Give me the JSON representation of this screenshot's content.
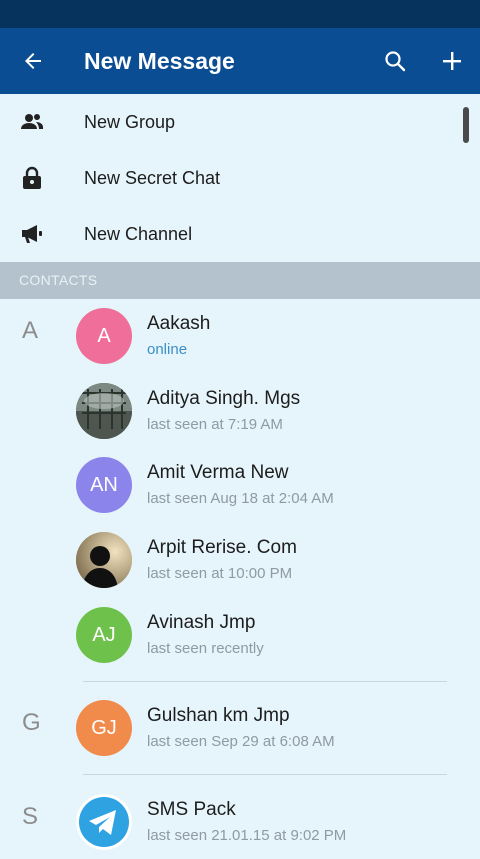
{
  "header": {
    "title": "New Message"
  },
  "actions": [
    {
      "label": "New Group",
      "icon": "group-icon"
    },
    {
      "label": "New Secret Chat",
      "icon": "lock-icon"
    },
    {
      "label": "New Channel",
      "icon": "megaphone-icon"
    }
  ],
  "section": {
    "title": "CONTACTS"
  },
  "contacts": [
    {
      "letter": "A",
      "initials": "A",
      "name": "Aakash",
      "status": "online",
      "color": "#ef6f9a"
    },
    {
      "letter": "",
      "initials": "",
      "name": "Aditya Singh. Mgs",
      "status": "last seen at 7:19 AM",
      "color": "#6d7a72"
    },
    {
      "letter": "",
      "initials": "AN",
      "name": "Amit Verma New",
      "status": "last seen Aug 18 at 2:04 AM",
      "color": "#8b84ea"
    },
    {
      "letter": "",
      "initials": "",
      "name": "Arpit Rerise. Com",
      "status": "last seen at 10:00 PM",
      "color": "#b3a07a"
    },
    {
      "letter": "",
      "initials": "AJ",
      "name": "Avinash Jmp",
      "status": "last seen recently",
      "color": "#6ec24c"
    },
    {
      "letter": "G",
      "initials": "GJ",
      "name": "Gulshan km Jmp",
      "status": "last seen Sep 29 at 6:08 AM",
      "color": "#f08b4b"
    },
    {
      "letter": "S",
      "initials": "",
      "name": "SMS Pack",
      "status": "last seen 21.01.15 at 9:02 PM",
      "color": "#2fa3e2"
    }
  ],
  "colors": {
    "status_bar": "#06335e",
    "app_bar": "#0a4d93",
    "background": "#e6f4fb",
    "section_header": "#b3c2cc",
    "online": "#3b8fc6"
  }
}
